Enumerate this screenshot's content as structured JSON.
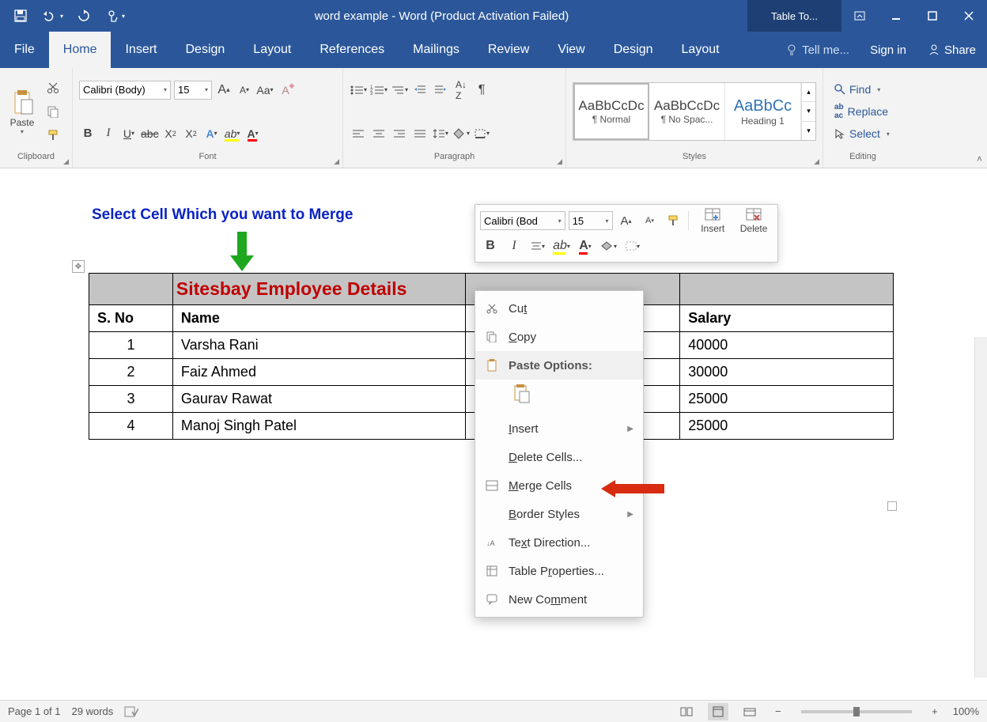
{
  "titlebar": {
    "title": "word example - Word (Product Activation Failed)",
    "table_tools": "Table To..."
  },
  "menubar": {
    "tabs": [
      "File",
      "Home",
      "Insert",
      "Design",
      "Layout",
      "References",
      "Mailings",
      "Review",
      "View",
      "Design",
      "Layout"
    ],
    "tellme": "Tell me...",
    "signin": "Sign in",
    "share": "Share"
  },
  "ribbon": {
    "clipboard": {
      "label": "Clipboard",
      "paste": "Paste"
    },
    "font": {
      "label": "Font",
      "name": "Calibri (Body)",
      "size": "15"
    },
    "paragraph": {
      "label": "Paragraph"
    },
    "styles": {
      "label": "Styles",
      "items": [
        {
          "preview": "AaBbCcDc",
          "name": "¶ Normal"
        },
        {
          "preview": "AaBbCcDc",
          "name": "¶ No Spac..."
        },
        {
          "preview": "AaBbCc",
          "name": "Heading 1"
        }
      ]
    },
    "editing": {
      "label": "Editing",
      "find": "Find",
      "replace": "Replace",
      "select": "Select"
    }
  },
  "annotation": "Select Cell Which you want to Merge",
  "table": {
    "title": "Sitesbay Employee Details",
    "headers": {
      "sno": "S. No",
      "name": "Name",
      "salary": "Salary"
    },
    "rows": [
      {
        "sno": "1",
        "name": "Varsha Rani",
        "salary": "40000"
      },
      {
        "sno": "2",
        "name": "Faiz Ahmed",
        "salary": "30000"
      },
      {
        "sno": "3",
        "name": "Gaurav Rawat",
        "salary": "25000"
      },
      {
        "sno": "4",
        "name": "Manoj Singh Patel",
        "salary": "25000"
      }
    ]
  },
  "mini_toolbar": {
    "font": "Calibri (Bod",
    "size": "15",
    "insert": "Insert",
    "delete": "Delete"
  },
  "context_menu": {
    "cut": "Cut",
    "copy": "Copy",
    "paste_options": "Paste Options:",
    "insert": "Insert",
    "delete_cells": "Delete Cells...",
    "merge_cells": "Merge Cells",
    "border_styles": "Border Styles",
    "text_direction": "Text Direction...",
    "table_properties": "Table Properties...",
    "new_comment": "New Comment"
  },
  "statusbar": {
    "page": "Page 1 of 1",
    "words": "29 words",
    "zoom": "100%"
  }
}
